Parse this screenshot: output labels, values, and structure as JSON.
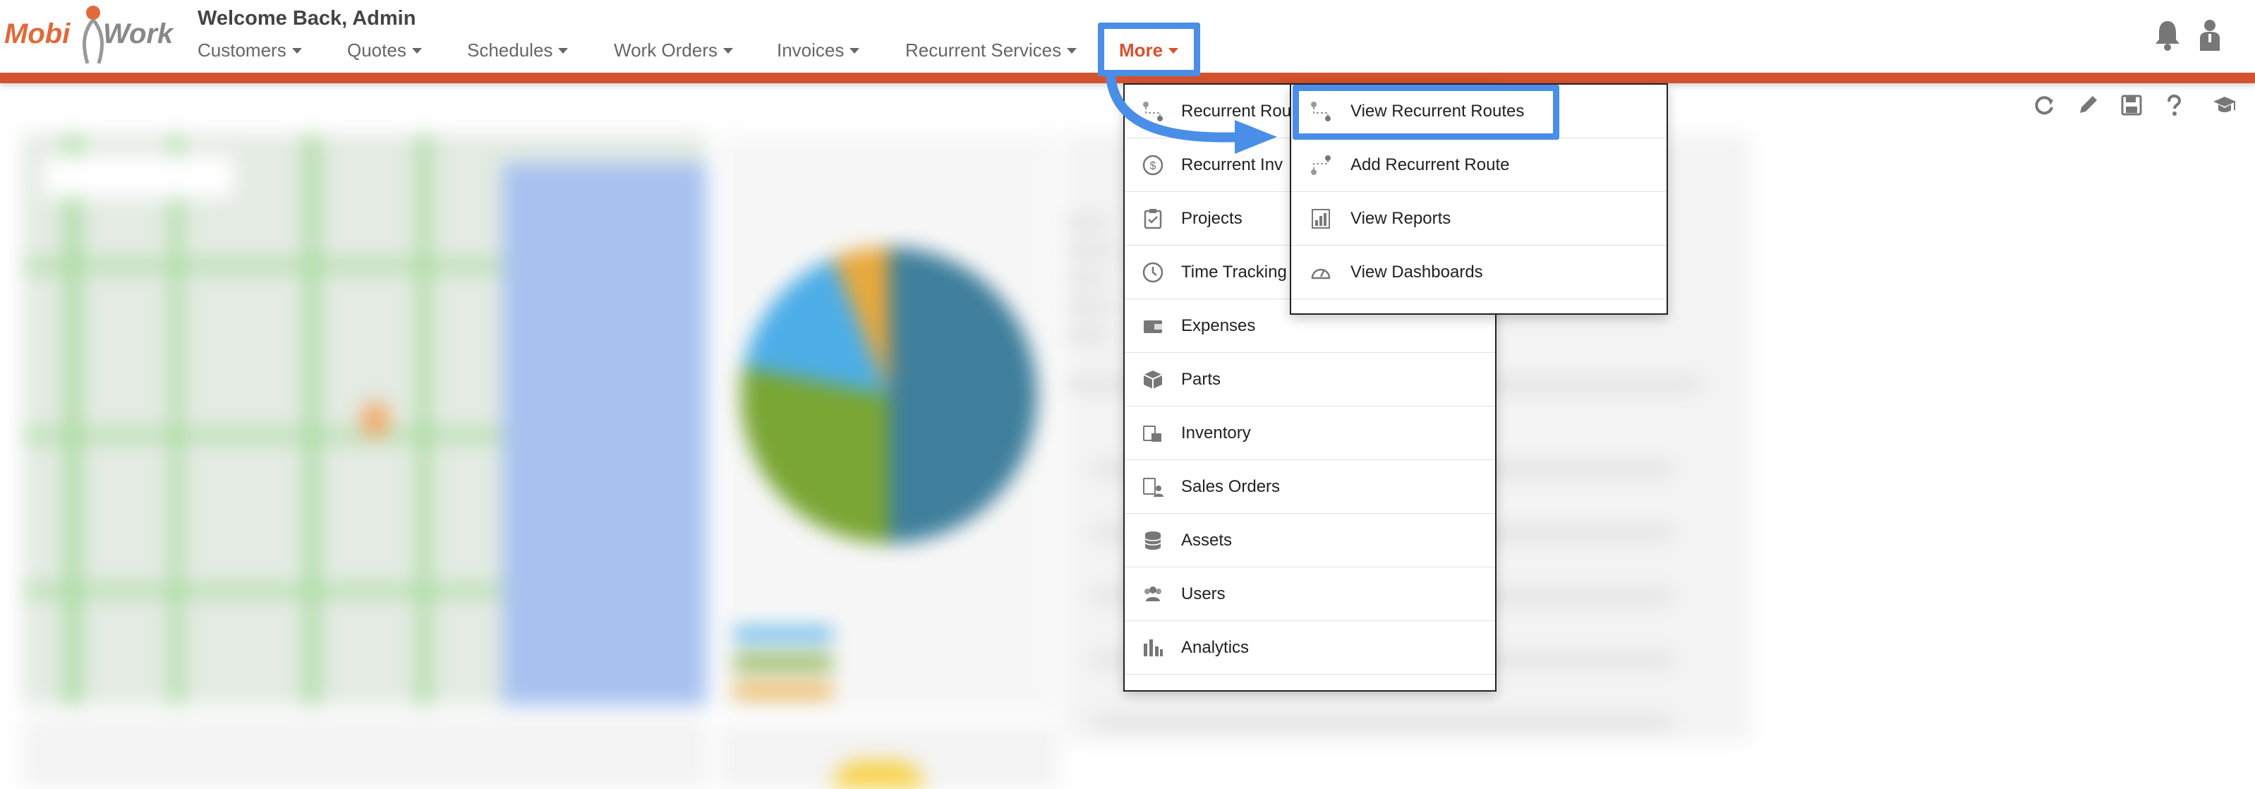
{
  "logo": {
    "left": "Mobi",
    "right": "Work"
  },
  "header": {
    "welcome": "Welcome Back,  Admin"
  },
  "nav": {
    "items": [
      {
        "label": "Customers"
      },
      {
        "label": "Quotes"
      },
      {
        "label": "Schedules"
      },
      {
        "label": "Work Orders"
      },
      {
        "label": "Invoices"
      },
      {
        "label": "Recurrent Services"
      },
      {
        "label": "More"
      }
    ]
  },
  "top_icons": [
    "bell-icon",
    "user-icon"
  ],
  "toolbar_icons": [
    "refresh-icon",
    "pencil-icon",
    "save-icon",
    "help-icon",
    "graduation-cap-icon"
  ],
  "more_menu": {
    "items": [
      {
        "label": "Recurrent Rou",
        "icon": "route-icon"
      },
      {
        "label": "Recurrent Inv",
        "icon": "dollar-circle-icon"
      },
      {
        "label": "Projects",
        "icon": "clipboard-check-icon"
      },
      {
        "label": "Time Tracking",
        "icon": "clock-icon"
      },
      {
        "label": "Expenses",
        "icon": "wallet-icon"
      },
      {
        "label": "Parts",
        "icon": "cube-icon"
      },
      {
        "label": "Inventory",
        "icon": "boxes-icon"
      },
      {
        "label": "Sales Orders",
        "icon": "sales-order-icon"
      },
      {
        "label": "Assets",
        "icon": "coins-icon"
      },
      {
        "label": "Users",
        "icon": "users-icon"
      },
      {
        "label": "Analytics",
        "icon": "bar-chart-icon"
      }
    ]
  },
  "recurrent_routes_submenu": {
    "items": [
      {
        "label": "View Recurrent Routes",
        "icon": "route-icon"
      },
      {
        "label": "Add Recurrent Route",
        "icon": "route-add-icon"
      },
      {
        "label": "View Reports",
        "icon": "report-icon"
      },
      {
        "label": "View Dashboards",
        "icon": "dashboard-gauge-icon"
      }
    ]
  },
  "colors": {
    "brand_orange": "#d4532e",
    "highlight_blue": "#4a8ee8",
    "nav_text": "#666666"
  }
}
